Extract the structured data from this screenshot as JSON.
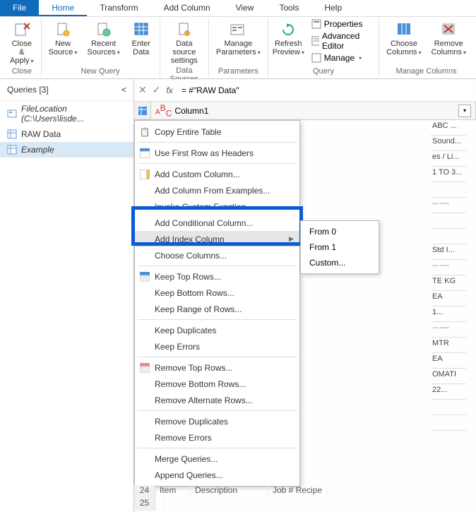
{
  "menu": {
    "file": "File",
    "home": "Home",
    "transform": "Transform",
    "addcol": "Add Column",
    "view": "View",
    "tools": "Tools",
    "help": "Help"
  },
  "ribbon": {
    "close": {
      "btn": "Close &\nApply",
      "group": "Close"
    },
    "newq": {
      "new": "New\nSource",
      "recent": "Recent\nSources",
      "enter": "Enter\nData",
      "group": "New Query"
    },
    "ds": {
      "btn": "Data source\nsettings",
      "group": "Data Sources"
    },
    "params": {
      "btn": "Manage\nParameters",
      "group": "Parameters"
    },
    "query": {
      "refresh": "Refresh\nPreview",
      "props": "Properties",
      "adv": "Advanced Editor",
      "manage": "Manage",
      "group": "Query"
    },
    "cols": {
      "choose": "Choose\nColumns",
      "remove": "Remove\nColumns",
      "group": "Manage Columns"
    }
  },
  "queries": {
    "title": "Queries [3]",
    "items": [
      {
        "label": "FileLocation (C:\\Users\\lisde...",
        "type": "param"
      },
      {
        "label": "RAW Data",
        "type": "table"
      },
      {
        "label": "Example",
        "type": "table"
      }
    ]
  },
  "fx": {
    "formula": "= #\"RAW Data\""
  },
  "column": {
    "name": "Column1",
    "type": "ABC"
  },
  "peek": [
    "ABC ...",
    "Sound...",
    "es / Li...",
    "1 TO 3...",
    "",
    "--- -----",
    "",
    "",
    "Std I...",
    "--- -----",
    "TE KG",
    "EA",
    "1...",
    "--- -----",
    "MTR",
    "EA",
    "OMATI",
    "22...",
    "",
    ""
  ],
  "bottom": [
    {
      "n": "24",
      "c1": "Item",
      "c2": "Description",
      "c3": "Job #  Recipe"
    },
    {
      "n": "25",
      "c1": "",
      "c2": "",
      "c3": ""
    }
  ],
  "ctx": {
    "copy": "Copy Entire Table",
    "firstrow": "Use First Row as Headers",
    "addcustom": "Add Custom Column...",
    "addexamples": "Add Column From Examples...",
    "invoke": "Invoke Custom Function...",
    "addcond": "Add Conditional Column...",
    "addindex": "Add Index Column",
    "choose": "Choose Columns...",
    "keeptop": "Keep Top Rows...",
    "keepbottom": "Keep Bottom Rows...",
    "keeprange": "Keep Range of Rows...",
    "keepdup": "Keep Duplicates",
    "keeperr": "Keep Errors",
    "removetop": "Remove Top Rows...",
    "removebottom": "Remove Bottom Rows...",
    "removealt": "Remove Alternate Rows...",
    "removedup": "Remove Duplicates",
    "removeerr": "Remove Errors",
    "merge": "Merge Queries...",
    "append": "Append Queries..."
  },
  "sub": {
    "from0": "From 0",
    "from1": "From 1",
    "custom": "Custom..."
  }
}
